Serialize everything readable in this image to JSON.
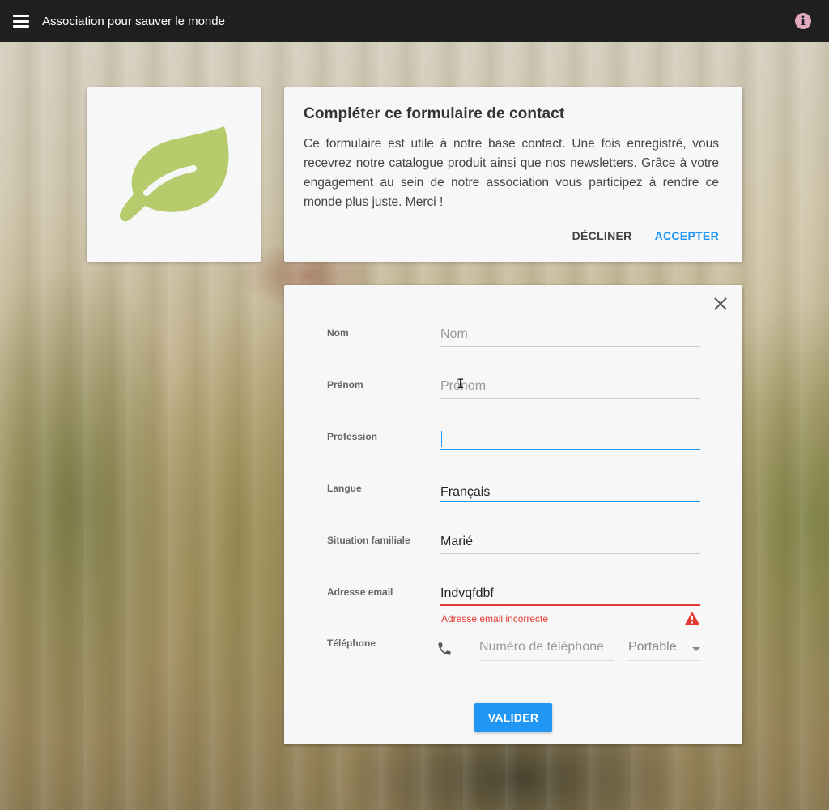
{
  "header": {
    "title": "Association pour sauver le monde",
    "menu_icon": "hamburger-menu-icon",
    "info_icon": "info-icon",
    "info_glyph": "i"
  },
  "intro": {
    "title": "Compléter ce formulaire de contact",
    "text": "Ce formulaire est utile à notre base contact. Une fois enregistré, vous recevrez notre catalogue produit ainsi que nos newsletters. Grâce à votre engagement au sein de notre association vous participez à rendre ce monde plus juste. Merci !",
    "decline_label": "DÉCLINER",
    "accept_label": "ACCEPTER"
  },
  "form": {
    "fields": {
      "nom": {
        "label": "Nom",
        "value": "",
        "placeholder": "Nom"
      },
      "prenom": {
        "label": "Prénom",
        "value": "",
        "placeholder": "Prénom"
      },
      "profession": {
        "label": "Profession",
        "value": "",
        "placeholder": ""
      },
      "langue": {
        "label": "Langue",
        "value": "Français"
      },
      "situation": {
        "label": "Situation familiale",
        "value": "Marié"
      },
      "email": {
        "label": "Adresse email",
        "value": "Indvqfdbf",
        "error": "Adresse email incorrecte"
      },
      "telephone": {
        "label": "Téléphone",
        "value": "",
        "placeholder": "Numéro de téléphone",
        "type_value": "Portable"
      }
    },
    "submit_label": "VALIDER"
  },
  "colors": {
    "accent": "#2196f3",
    "error": "#e53935",
    "leaf": "#b5cb6c",
    "topbar": "#1f1f1f"
  }
}
